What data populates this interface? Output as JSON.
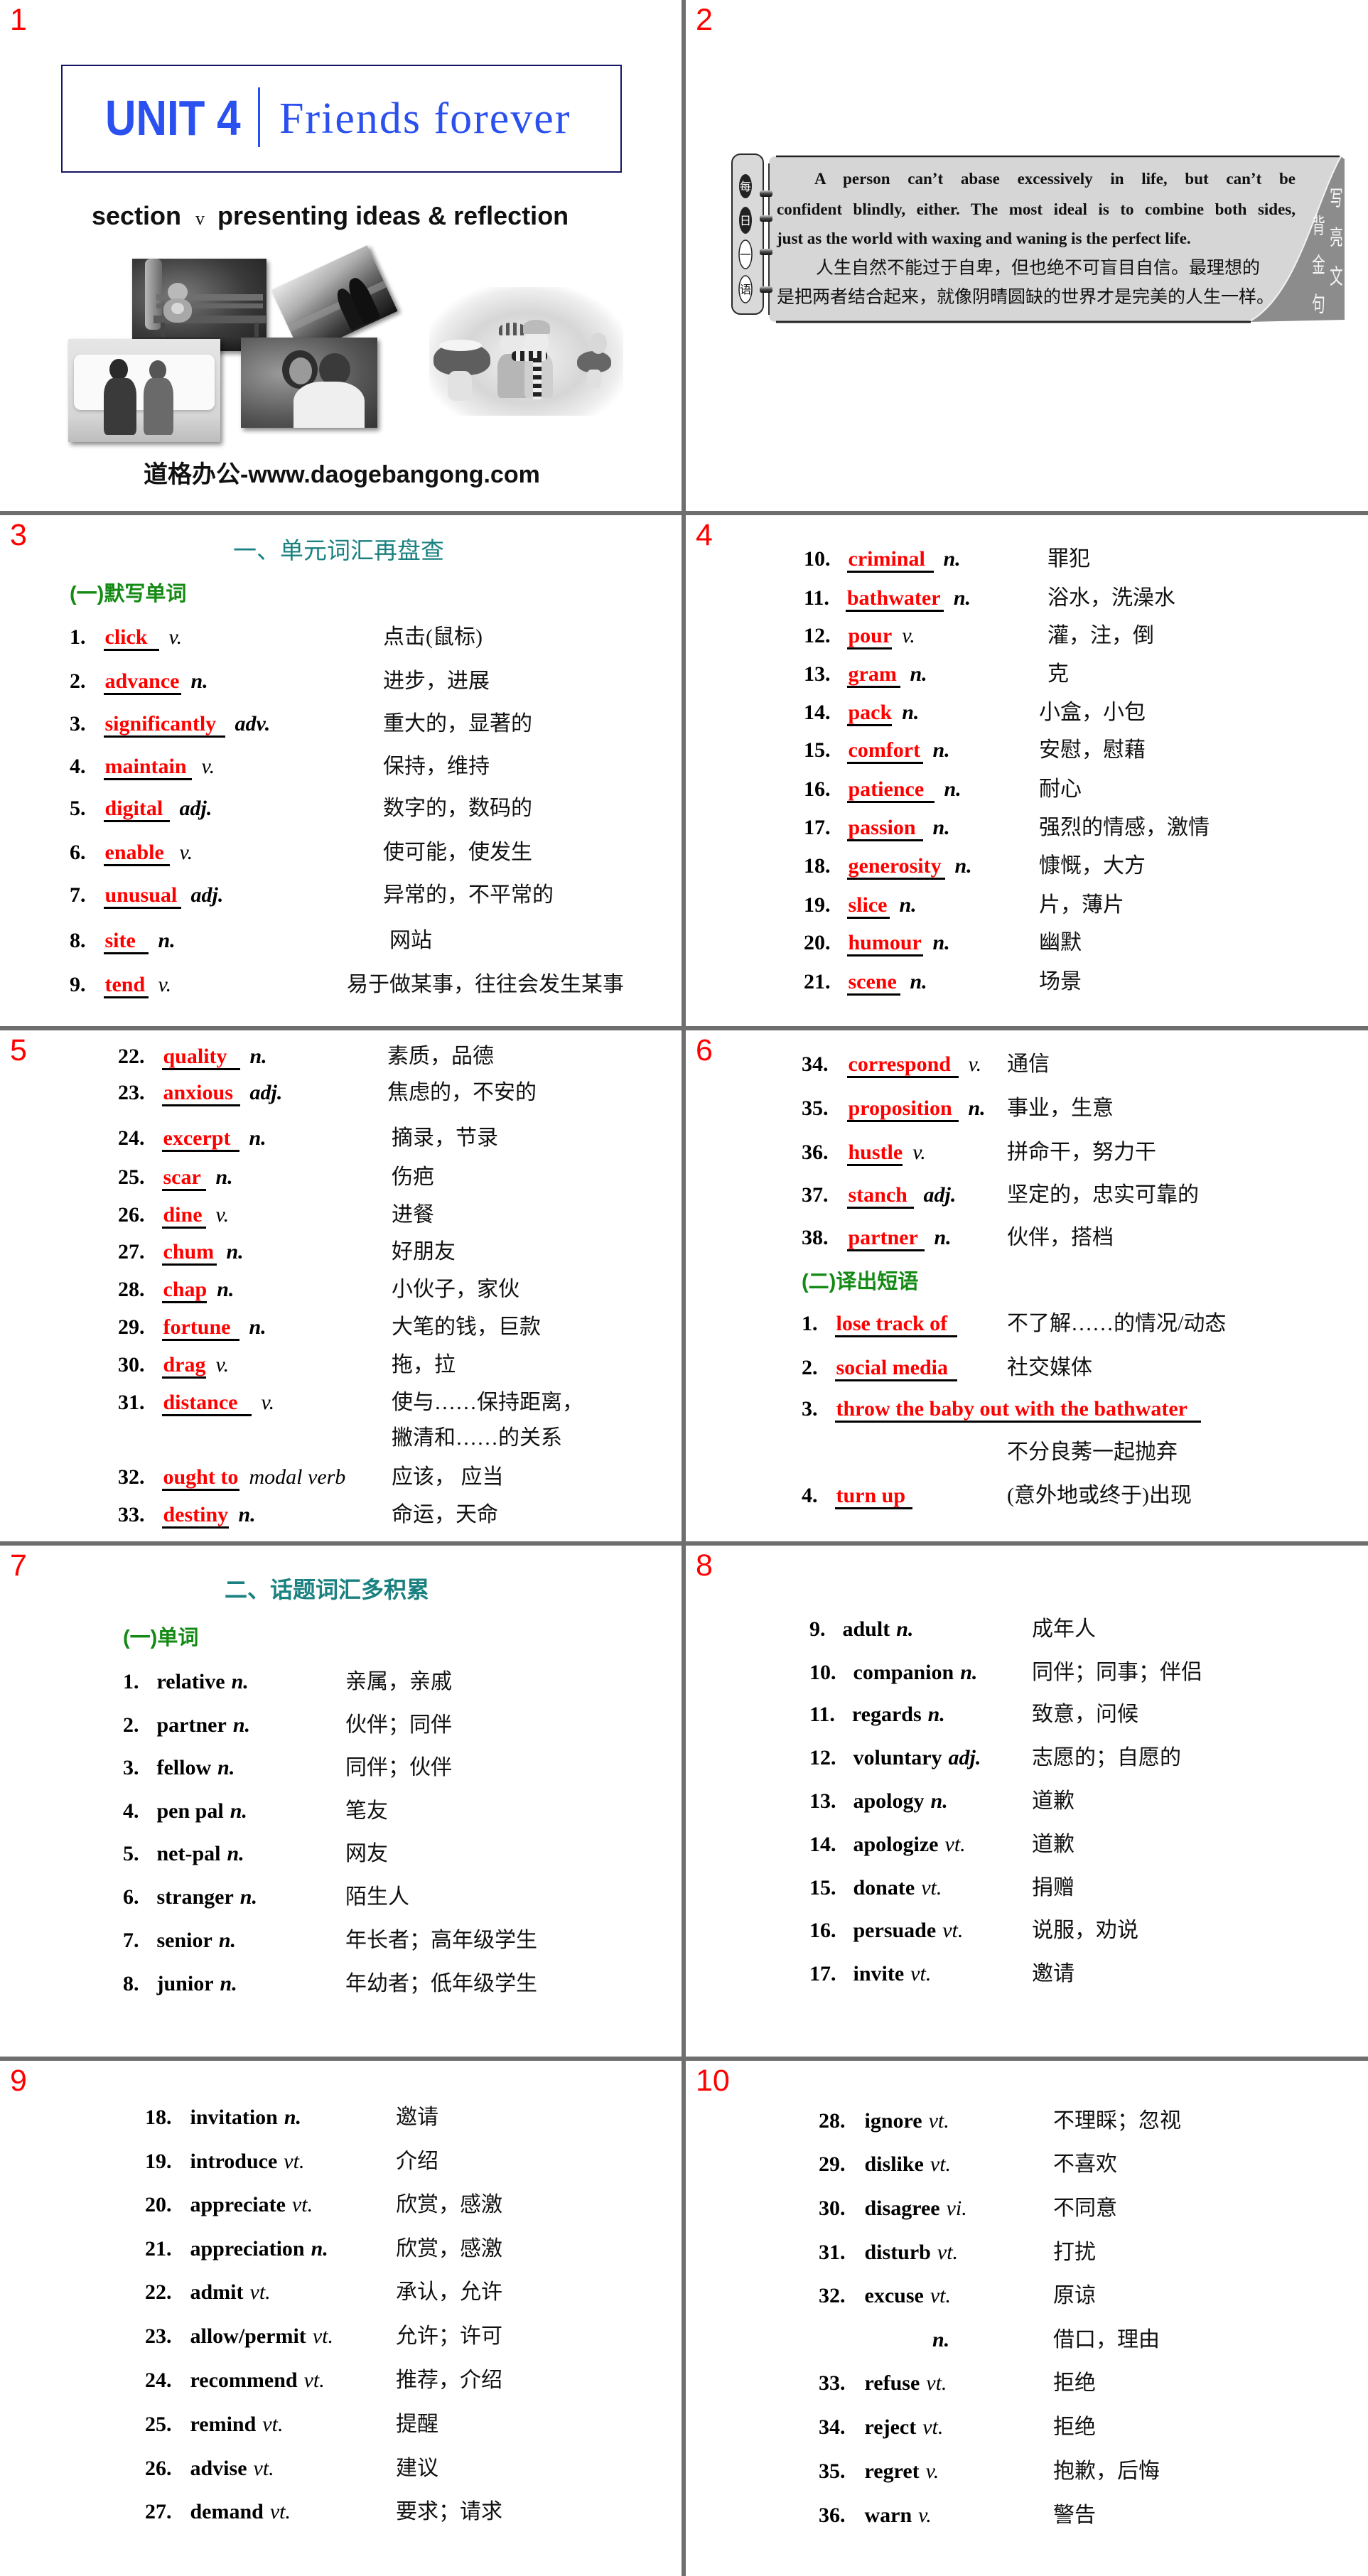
{
  "colors": {
    "slide_number": "#ff0000",
    "answer": "#ff0000",
    "heading": "#1a8080",
    "subheading": "#138a13",
    "title": "#2b50f0",
    "divider": "#6e6e6e"
  },
  "slides": [
    {
      "number": "1",
      "title": {
        "unit": "UNIT 4",
        "name": "Friends forever"
      },
      "section": {
        "label": "section",
        "numeral": "v",
        "name": "presenting ideas & reflection"
      },
      "footer": "道格办公-www.daogebangong.com"
    },
    {
      "number": "2",
      "side_label": [
        "每",
        "日",
        "一",
        "语"
      ],
      "english_lines": [
        "A person can’t abase excessively in life, but can’t be",
        "confident blindly, either. The most ideal is to combine both sides,",
        "just as the world with waxing and waning is the perfect life."
      ],
      "chinese_lines": [
        "人生自然不能过于自卑，但也绝不可盲目自信。最理想的",
        "是把两者结合起来，就像阴晴圆缺的世界才是完美的人生一样。"
      ],
      "side_text": [
        "写亮文",
        "背金句"
      ]
    },
    {
      "number": "3",
      "heading": "一、单元词汇再盘查",
      "subheading": "(一)默写单词",
      "items": [
        {
          "num": "1.",
          "answer": "click",
          "pos": "v.",
          "meaning": "点击(鼠标)"
        },
        {
          "num": "2.",
          "answer": "advance",
          "pos": "n.",
          "meaning": "进步，进展"
        },
        {
          "num": "3.",
          "answer": "significantly",
          "pos": "adv.",
          "meaning": "重大的，显著的"
        },
        {
          "num": "4.",
          "answer": "maintain",
          "pos": "v.",
          "meaning": "保持，维持"
        },
        {
          "num": "5.",
          "answer": "digital",
          "pos": "adj.",
          "meaning": "数字的，数码的"
        },
        {
          "num": "6.",
          "answer": "enable",
          "pos": "v.",
          "meaning": "使可能，使发生"
        },
        {
          "num": "7.",
          "answer": "unusual",
          "pos": "adj.",
          "meaning": "异常的，不平常的"
        },
        {
          "num": "8.",
          "answer": "site",
          "pos": "n.",
          "meaning": "网站"
        },
        {
          "num": "9.",
          "answer": "tend",
          "pos": "v.",
          "meaning": "易于做某事，往往会发生某事"
        }
      ]
    },
    {
      "number": "4",
      "items": [
        {
          "num": "10.",
          "answer": "criminal",
          "pos": "n.",
          "meaning": "罪犯"
        },
        {
          "num": "11.",
          "answer": "bathwater",
          "pos": "n.",
          "meaning": "浴水，洗澡水"
        },
        {
          "num": "12.",
          "answer": "pour",
          "pos": "v.",
          "meaning": "灌，注，倒"
        },
        {
          "num": "13.",
          "answer": "gram",
          "pos": "n.",
          "meaning": "克"
        },
        {
          "num": "14.",
          "answer": "pack",
          "pos": "n.",
          "meaning": "小盒，小包"
        },
        {
          "num": "15.",
          "answer": "comfort",
          "pos": "n.",
          "meaning": "安慰，慰藉"
        },
        {
          "num": "16.",
          "answer": "patience",
          "pos": "n.",
          "meaning": "耐心"
        },
        {
          "num": "17.",
          "answer": "passion",
          "pos": "n.",
          "meaning": "强烈的情感，激情"
        },
        {
          "num": "18.",
          "answer": "generosity",
          "pos": "n.",
          "meaning": "慷慨，大方"
        },
        {
          "num": "19.",
          "answer": "slice",
          "pos": "n.",
          "meaning": "片，薄片"
        },
        {
          "num": "20.",
          "answer": "humour",
          "pos": "n.",
          "meaning": "幽默"
        },
        {
          "num": "21.",
          "answer": "scene",
          "pos": "n.",
          "meaning": "场景"
        }
      ]
    },
    {
      "number": "5",
      "items": [
        {
          "num": "22.",
          "answer": "quality",
          "pos": "n.",
          "meaning": "素质，品德"
        },
        {
          "num": "23.",
          "answer": "anxious",
          "pos": "adj.",
          "meaning": "焦虑的，不安的"
        },
        {
          "num": "24.",
          "answer": "excerpt",
          "pos": "n.",
          "meaning": "摘录，节录"
        },
        {
          "num": "25.",
          "answer": "scar",
          "pos": "n.",
          "meaning": "伤疤"
        },
        {
          "num": "26.",
          "answer": "dine",
          "pos": "v.",
          "meaning": "进餐"
        },
        {
          "num": "27.",
          "answer": "chum",
          "pos": "n.",
          "meaning": "好朋友"
        },
        {
          "num": "28.",
          "answer": "chap",
          "pos": "n.",
          "meaning": "小伙子，家伙"
        },
        {
          "num": "29.",
          "answer": "fortune",
          "pos": "n.",
          "meaning": "大笔的钱，巨款"
        },
        {
          "num": "30.",
          "answer": "drag",
          "pos": "v.",
          "meaning": "拖，拉"
        },
        {
          "num": "31.",
          "answer": "distance",
          "pos": "v.",
          "meaning": "使与……保持距离，",
          "meaning_cont": "撇清和……的关系"
        },
        {
          "num": "32.",
          "answer": "ought to",
          "pos": "modal verb",
          "meaning": "应该，  应当"
        },
        {
          "num": "33.",
          "answer": "destiny",
          "pos": "n.",
          "meaning": "命运，天命"
        }
      ]
    },
    {
      "number": "6",
      "items": [
        {
          "num": "34.",
          "answer": "correspond",
          "pos": "v.",
          "meaning": "通信"
        },
        {
          "num": "35.",
          "answer": "proposition",
          "pos": "n.",
          "meaning": "事业，生意"
        },
        {
          "num": "36.",
          "answer": "hustle",
          "pos": "v.",
          "meaning": "拼命干，努力干"
        },
        {
          "num": "37.",
          "answer": "stanch",
          "pos": "adj.",
          "meaning": "坚定的，忠实可靠的"
        },
        {
          "num": "38.",
          "answer": "partner",
          "pos": "n.",
          "meaning": "伙伴，搭档"
        }
      ],
      "subheading": "(二)译出短语",
      "phrases": [
        {
          "num": "1.",
          "answer": "lose track of",
          "meaning": "不了解……的情况/动态"
        },
        {
          "num": "2.",
          "answer": "social media",
          "meaning": "社交媒体"
        },
        {
          "num": "3.",
          "answer": "throw the baby out with the bathwater",
          "meaning": "不分良莠一起抛弃"
        },
        {
          "num": "4.",
          "answer": "turn up",
          "meaning": "(意外地或终于)出现"
        }
      ]
    },
    {
      "number": "7",
      "heading": "二、话题词汇多积累",
      "subheading": "(一)单词",
      "items": [
        {
          "num": "1.",
          "word": "relative",
          "pos": "n.",
          "meaning": "亲属，亲戚"
        },
        {
          "num": "2.",
          "word": "partner",
          "pos": "n.",
          "meaning": "伙伴；同伴"
        },
        {
          "num": "3.",
          "word": "fellow",
          "pos": "n.",
          "meaning": "同伴；伙伴"
        },
        {
          "num": "4.",
          "word": "pen pal",
          "pos": "n.",
          "meaning": "笔友"
        },
        {
          "num": "5.",
          "word": "net-pal",
          "pos": "n.",
          "meaning": "网友"
        },
        {
          "num": "6.",
          "word": "stranger",
          "pos": "n.",
          "meaning": "陌生人"
        },
        {
          "num": "7.",
          "word": "senior",
          "pos": "n.",
          "meaning": "年长者；高年级学生"
        },
        {
          "num": "8.",
          "word": "junior",
          "pos": "n.",
          "meaning": "年幼者；低年级学生"
        }
      ]
    },
    {
      "number": "8",
      "items": [
        {
          "num": "9.",
          "word": "adult",
          "pos": "n.",
          "meaning": "成年人"
        },
        {
          "num": "10.",
          "word": "companion",
          "pos": "n.",
          "meaning": "同伴；同事；伴侣"
        },
        {
          "num": "11.",
          "word": "regards",
          "pos": "n.",
          "meaning": "致意，问候"
        },
        {
          "num": "12.",
          "word": "voluntary",
          "pos": "adj.",
          "meaning": "志愿的；自愿的"
        },
        {
          "num": "13.",
          "word": "apology",
          "pos": "n.",
          "meaning": "道歉"
        },
        {
          "num": "14.",
          "word": "apologize",
          "pos": "vt.",
          "meaning": "道歉"
        },
        {
          "num": "15.",
          "word": "donate",
          "pos": "vt.",
          "meaning": "捐赠"
        },
        {
          "num": "16.",
          "word": "persuade",
          "pos": "vt.",
          "meaning": "说服，劝说"
        },
        {
          "num": "17.",
          "word": "invite",
          "pos": "vt.",
          "meaning": "邀请"
        }
      ]
    },
    {
      "number": "9",
      "items": [
        {
          "num": "18.",
          "word": "invitation",
          "pos": "n.",
          "meaning": "邀请"
        },
        {
          "num": "19.",
          "word": "introduce",
          "pos": "vt.",
          "meaning": "介绍"
        },
        {
          "num": "20.",
          "word": "appreciate",
          "pos": "vt.",
          "meaning": "欣赏，感激"
        },
        {
          "num": "21.",
          "word": "appreciation",
          "pos": "n.",
          "meaning": "欣赏，感激"
        },
        {
          "num": "22.",
          "word": "admit",
          "pos": "vt.",
          "meaning": "承认，允许"
        },
        {
          "num": "23.",
          "word": "allow/permit",
          "pos": "vt.",
          "meaning": "允许；许可"
        },
        {
          "num": "24.",
          "word": "recommend",
          "pos": "vt.",
          "meaning": "推荐，介绍"
        },
        {
          "num": "25.",
          "word": "remind",
          "pos": "vt.",
          "meaning": "提醒"
        },
        {
          "num": "26.",
          "word": "advise",
          "pos": "vt.",
          "meaning": "建议"
        },
        {
          "num": "27.",
          "word": "demand",
          "pos": "vt.",
          "meaning": "要求；请求"
        }
      ]
    },
    {
      "number": "10",
      "items": [
        {
          "num": "28.",
          "word": "ignore",
          "pos": "vt.",
          "meaning": "不理睬；忽视"
        },
        {
          "num": "29.",
          "word": "dislike",
          "pos": "vt.",
          "meaning": "不喜欢"
        },
        {
          "num": "30.",
          "word": "disagree",
          "pos": "vi.",
          "meaning": "不同意"
        },
        {
          "num": "31.",
          "word": "disturb",
          "pos": "vt.",
          "meaning": "打扰"
        },
        {
          "num": "32.",
          "word": "excuse",
          "pos": "vt.",
          "meaning": "原谅"
        },
        {
          "pos": "n.",
          "meaning": "借口，理由"
        },
        {
          "num": "33.",
          "word": "refuse",
          "pos": "vt.",
          "meaning": "拒绝"
        },
        {
          "num": "34.",
          "word": "reject",
          "pos": "vt.",
          "meaning": "拒绝"
        },
        {
          "num": "35.",
          "word": "regret",
          "pos": "v.",
          "meaning": "抱歉，后悔"
        },
        {
          "num": "36.",
          "word": "warn",
          "pos": "v.",
          "meaning": "警告"
        }
      ]
    }
  ]
}
